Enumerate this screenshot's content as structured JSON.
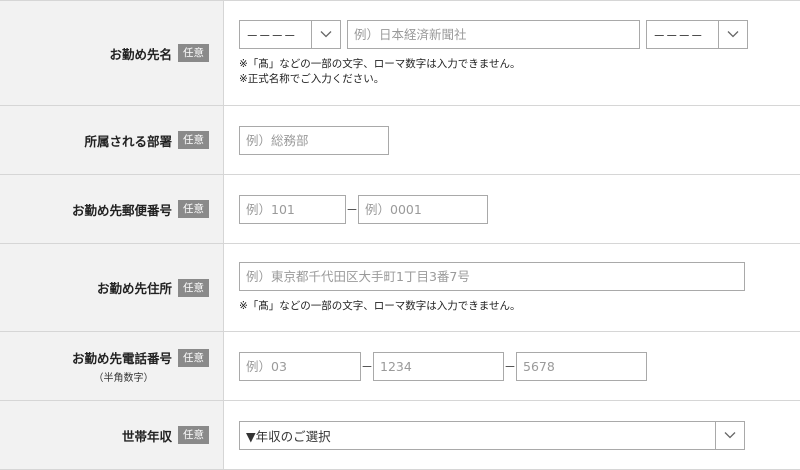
{
  "rows": {
    "company_name": {
      "label": "お勤め先名",
      "badge": "任意",
      "prefix_select": "－－－－",
      "input_placeholder": "例）日本経済新聞社",
      "suffix_select": "－－－－",
      "notes": [
        "※「髙」などの一部の文字、ローマ数字は入力できません。",
        "※正式名称でご入力ください。"
      ]
    },
    "department": {
      "label": "所属される部署",
      "badge": "任意",
      "input_placeholder": "例）総務部"
    },
    "postal_code": {
      "label": "お勤め先郵便番号",
      "badge": "任意",
      "input1_placeholder": "例）101",
      "separator": "－",
      "input2_placeholder": "例）0001"
    },
    "address": {
      "label": "お勤め先住所",
      "badge": "任意",
      "input_placeholder": "例）東京都千代田区大手町1丁目3番7号",
      "note": "※「髙」などの一部の文字、ローマ数字は入力できません。"
    },
    "phone": {
      "label": "お勤め先電話番号",
      "sub_label": "（半角数字）",
      "badge": "任意",
      "input1_placeholder": "例）03",
      "separator": "－",
      "input2_placeholder": "1234",
      "input3_placeholder": "5678"
    },
    "income": {
      "label": "世帯年収",
      "badge": "任意",
      "select_value": "▼年収のご選択"
    }
  }
}
